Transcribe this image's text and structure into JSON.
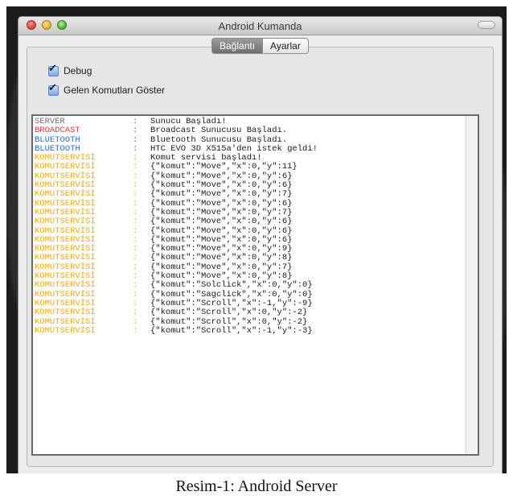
{
  "window": {
    "title": "Android Kumanda"
  },
  "tabs": [
    {
      "label": "Bağlantı",
      "active": true
    },
    {
      "label": "Ayarlar",
      "active": false
    }
  ],
  "options": [
    {
      "label": "Debug",
      "checked": true
    },
    {
      "label": "Gelen Komutları Göster",
      "checked": true
    }
  ],
  "log": {
    "separator": ":",
    "colors": {
      "SERVER": "#6b6b6b",
      "BROADCAST": "#e53935",
      "BLUETOOTH": "#1e6fd9",
      "KOMUTSERVİSİ": "#f0a818"
    },
    "lines": [
      {
        "source": "SERVER",
        "message": "Sunucu Başladı!"
      },
      {
        "source": "BROADCAST",
        "message": "Broadcast Sunucusu Başladı."
      },
      {
        "source": "BLUETOOTH",
        "message": "Bluetooth Sunucusu Başladı."
      },
      {
        "source": "BLUETOOTH",
        "message": "HTC EVO 3D X515a'den istek geldi!"
      },
      {
        "source": "KOMUTSERVİSİ",
        "message": "Komut servisi başladı!"
      },
      {
        "source": "KOMUTSERVİSİ",
        "message": "{\"komut\":\"Move\",\"x\":0,\"y\":11}"
      },
      {
        "source": "KOMUTSERVİSİ",
        "message": "{\"komut\":\"Move\",\"x\":0,\"y\":6}"
      },
      {
        "source": "KOMUTSERVİSİ",
        "message": "{\"komut\":\"Move\",\"x\":0,\"y\":6}"
      },
      {
        "source": "KOMUTSERVİSİ",
        "message": "{\"komut\":\"Move\",\"x\":0,\"y\":7}"
      },
      {
        "source": "KOMUTSERVİSİ",
        "message": "{\"komut\":\"Move\",\"x\":0,\"y\":6}"
      },
      {
        "source": "KOMUTSERVİSİ",
        "message": "{\"komut\":\"Move\",\"x\":0,\"y\":7}"
      },
      {
        "source": "KOMUTSERVİSİ",
        "message": "{\"komut\":\"Move\",\"x\":0,\"y\":6}"
      },
      {
        "source": "KOMUTSERVİSİ",
        "message": "{\"komut\":\"Move\",\"x\":0,\"y\":6}"
      },
      {
        "source": "KOMUTSERVİSİ",
        "message": "{\"komut\":\"Move\",\"x\":0,\"y\":6}"
      },
      {
        "source": "KOMUTSERVİSİ",
        "message": "{\"komut\":\"Move\",\"x\":0,\"y\":9}"
      },
      {
        "source": "KOMUTSERVİSİ",
        "message": "{\"komut\":\"Move\",\"x\":0,\"y\":8}"
      },
      {
        "source": "KOMUTSERVİSİ",
        "message": "{\"komut\":\"Move\",\"x\":0,\"y\":7}"
      },
      {
        "source": "KOMUTSERVİSİ",
        "message": "{\"komut\":\"Move\",\"x\":0,\"y\":8}"
      },
      {
        "source": "KOMUTSERVİSİ",
        "message": "{\"komut\":\"Solclick\",\"x\":0,\"y\":0}"
      },
      {
        "source": "KOMUTSERVİSİ",
        "message": "{\"komut\":\"Sagclick\",\"x\":0,\"y\":0}"
      },
      {
        "source": "KOMUTSERVİSİ",
        "message": "{\"komut\":\"Scroll\",\"x\":-1,\"y\":-9}"
      },
      {
        "source": "KOMUTSERVİSİ",
        "message": "{\"komut\":\"Scroll\",\"x\":0,\"y\":-2}"
      },
      {
        "source": "KOMUTSERVİSİ",
        "message": "{\"komut\":\"Scroll\",\"x\":0,\"y\":-2}"
      },
      {
        "source": "KOMUTSERVİSİ",
        "message": "{\"komut\":\"Scroll\",\"x\":-1,\"y\":-3}"
      }
    ]
  },
  "caption": "Resim-1: Android Server"
}
